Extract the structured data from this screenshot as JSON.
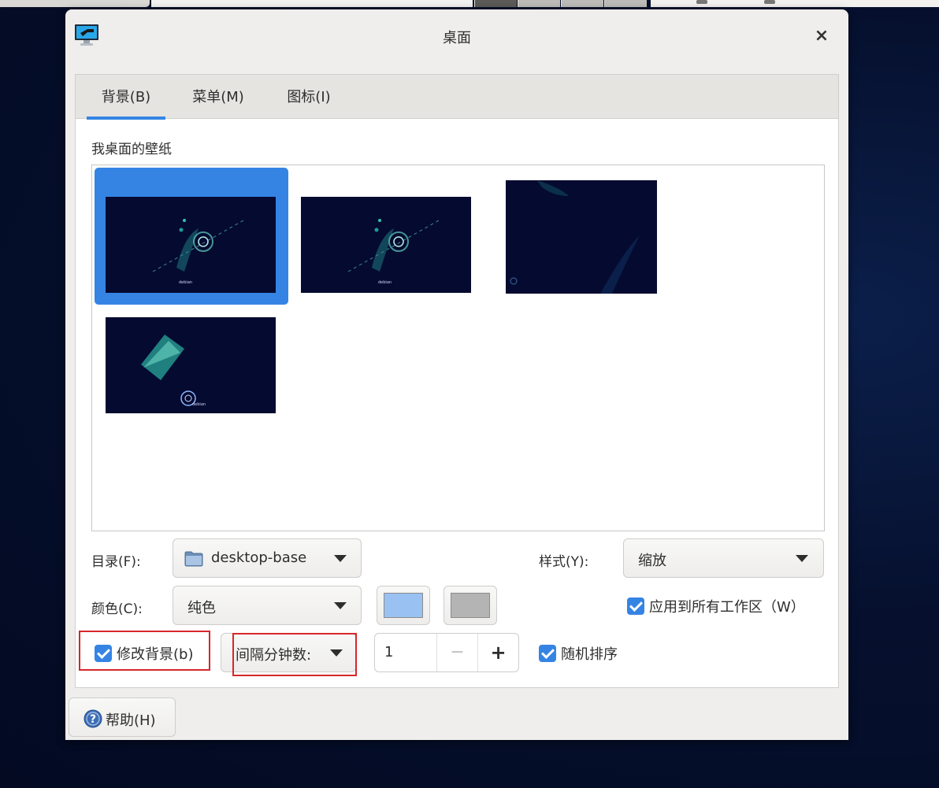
{
  "window": {
    "title": "桌面",
    "close_glyph": "×",
    "icon": "desktop-monitor-icon"
  },
  "tabs": [
    {
      "label": "背景(B)",
      "active": true
    },
    {
      "label": "菜单(M)",
      "active": false
    },
    {
      "label": "图标(I)",
      "active": false
    }
  ],
  "wallpapers": {
    "section_label": "我桌面的壁纸",
    "items": [
      {
        "caption": "debian",
        "selected": true
      },
      {
        "caption": "debian",
        "selected": false
      },
      {
        "caption": "",
        "selected": false
      },
      {
        "caption": "debian",
        "selected": false
      }
    ]
  },
  "directory": {
    "label": "目录(F):",
    "value": "desktop-base",
    "icon": "folder-icon"
  },
  "style": {
    "label": "样式(Y):",
    "value": "缩放"
  },
  "color": {
    "label": "颜色(C):",
    "value": "纯色",
    "primary": "#99c1f1",
    "secondary": "#b4b4b4"
  },
  "apply_all": {
    "label": "应用到所有工作区（W）",
    "checked": true
  },
  "change_background": {
    "label": "修改背景(b)",
    "checked": true
  },
  "interval": {
    "label": "间隔分钟数:",
    "value": "1",
    "dec": "−",
    "inc": "+"
  },
  "random_order": {
    "label": "随机排序",
    "checked": true
  },
  "help": {
    "label": "帮助(H)",
    "icon": "help-icon"
  },
  "colors": {
    "accent": "#3584e4",
    "highlight_box": "#d7262a"
  }
}
